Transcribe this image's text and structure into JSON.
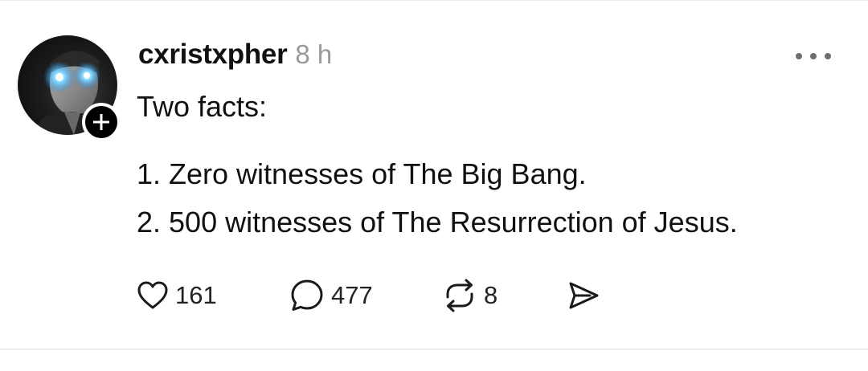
{
  "post": {
    "author": {
      "username": "cxristxpher",
      "avatar_icon": "profile-photo-glowing-eyes",
      "follow_icon": "plus-icon"
    },
    "timestamp": "8 h",
    "more_icon": "more-options-icon",
    "text": {
      "intro": "Two facts:",
      "lines": [
        "1. Zero witnesses of The Big Bang.",
        "2. 500 witnesses of The Resurrection of Jesus."
      ]
    },
    "actions": {
      "likes": {
        "icon": "heart-icon",
        "count": "161"
      },
      "replies": {
        "icon": "comment-icon",
        "count": "477"
      },
      "reposts": {
        "icon": "repost-icon",
        "count": "8"
      },
      "share": {
        "icon": "send-icon"
      }
    }
  },
  "colors": {
    "text": "#111111",
    "muted": "#9a9a9a",
    "divider": "#ececec",
    "eye_glow": "#4fc3ff"
  }
}
